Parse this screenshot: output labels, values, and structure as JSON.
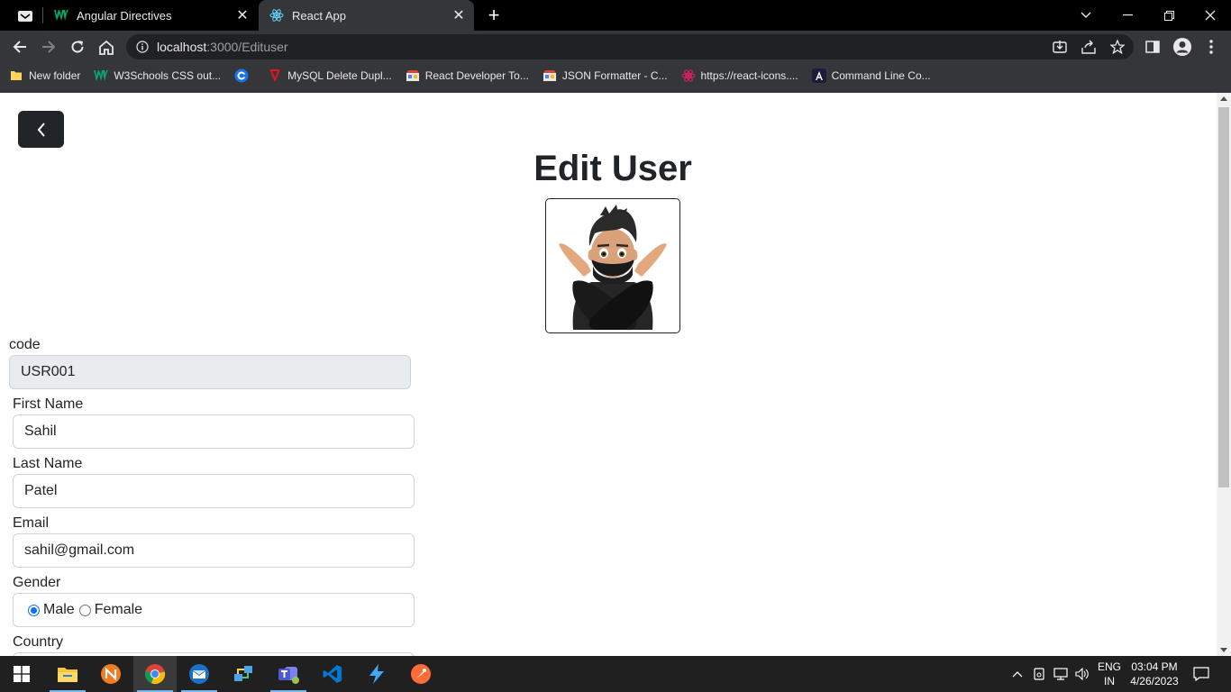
{
  "browser": {
    "tabs": [
      {
        "title": "Angular Directives",
        "active": false,
        "icon": "w3schools-icon"
      },
      {
        "title": "React App",
        "active": true,
        "icon": "react-icon"
      }
    ],
    "url_host": "localhost",
    "url_path": ":3000/Edituser",
    "bookmarks": [
      {
        "label": "New folder",
        "icon": "folder-icon"
      },
      {
        "label": "W3Schools CSS out...",
        "icon": "w3schools-icon"
      },
      {
        "label": "",
        "icon": "chrome-web-store-icon"
      },
      {
        "label": "MySQL Delete Dupl...",
        "icon": "mysql-tutorial-icon"
      },
      {
        "label": "React Developer To...",
        "icon": "store-icon"
      },
      {
        "label": "JSON Formatter - C...",
        "icon": "store-icon"
      },
      {
        "label": "https://react-icons....",
        "icon": "react-icons-icon"
      },
      {
        "label": "Command Line Co...",
        "icon": "angular-cli-icon"
      }
    ]
  },
  "page": {
    "title": "Edit User",
    "fields": {
      "code": {
        "label": "code",
        "value": "USR001"
      },
      "first_name": {
        "label": "First Name",
        "value": "Sahil"
      },
      "last_name": {
        "label": "Last Name",
        "value": "Patel"
      },
      "email": {
        "label": "Email",
        "value": "sahil@gmail.com"
      },
      "gender": {
        "label": "Gender",
        "options": [
          "Male",
          "Female"
        ],
        "selected": "Male"
      },
      "country": {
        "label": "Country"
      }
    }
  },
  "taskbar": {
    "language_top": "ENG",
    "language_bottom": "IN",
    "time": "03:04 PM",
    "date": "4/26/2023"
  },
  "colors": {
    "primary": "#0d6efd",
    "dark_button": "#212529",
    "disabled_input": "#e9ecef"
  }
}
